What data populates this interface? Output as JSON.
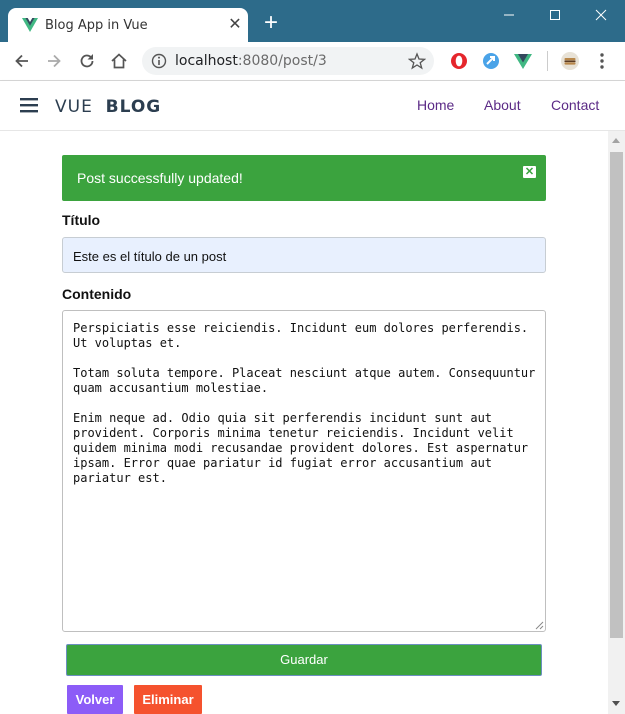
{
  "browser": {
    "tab_title": "Blog App in Vue",
    "tab_close": "✕",
    "new_tab": "+",
    "url_host": "localhost",
    "url_rest": ":8080/post/3",
    "colors": {
      "titlebar": "#2d6b8a"
    },
    "icons": [
      "vue-favicon-icon",
      "back-arrow-icon",
      "forward-arrow-icon",
      "reload-icon",
      "home-icon",
      "info-icon",
      "star-icon",
      "opera-extension-icon",
      "blue-extension-icon",
      "vue-devtools-icon",
      "profile-avatar-icon",
      "menu-dots-icon"
    ]
  },
  "navbar": {
    "logo_light": "VUE",
    "logo_bold": "BLOG",
    "links": [
      "Home",
      "About",
      "Contact"
    ],
    "link_color": "#5b2a86"
  },
  "alert": {
    "message": "Post successfully updated!",
    "color": "#3ba33e"
  },
  "form": {
    "title_label": "Título",
    "title_value": "Este es el título de un post",
    "content_label": "Contenido",
    "content_value": "Perspiciatis esse reiciendis. Incidunt eum dolores perferendis. Ut voluptas et.\n\nTotam soluta tempore. Placeat nesciunt atque autem. Consequuntur quam accusantium molestiae.\n\nEnim neque ad. Odio quia sit perferendis incidunt sunt aut provident. Corporis minima tenetur reiciendis. Incidunt velit quidem minima modi recusandae provident dolores. Est aspernatur ipsam. Error quae pariatur id fugiat error accusantium aut pariatur est.",
    "save_label": "Guardar",
    "back_label": "Volver",
    "delete_label": "Eliminar",
    "colors": {
      "save": "#3ba33e",
      "back": "#8c5cf7",
      "delete": "#f5522e"
    }
  }
}
